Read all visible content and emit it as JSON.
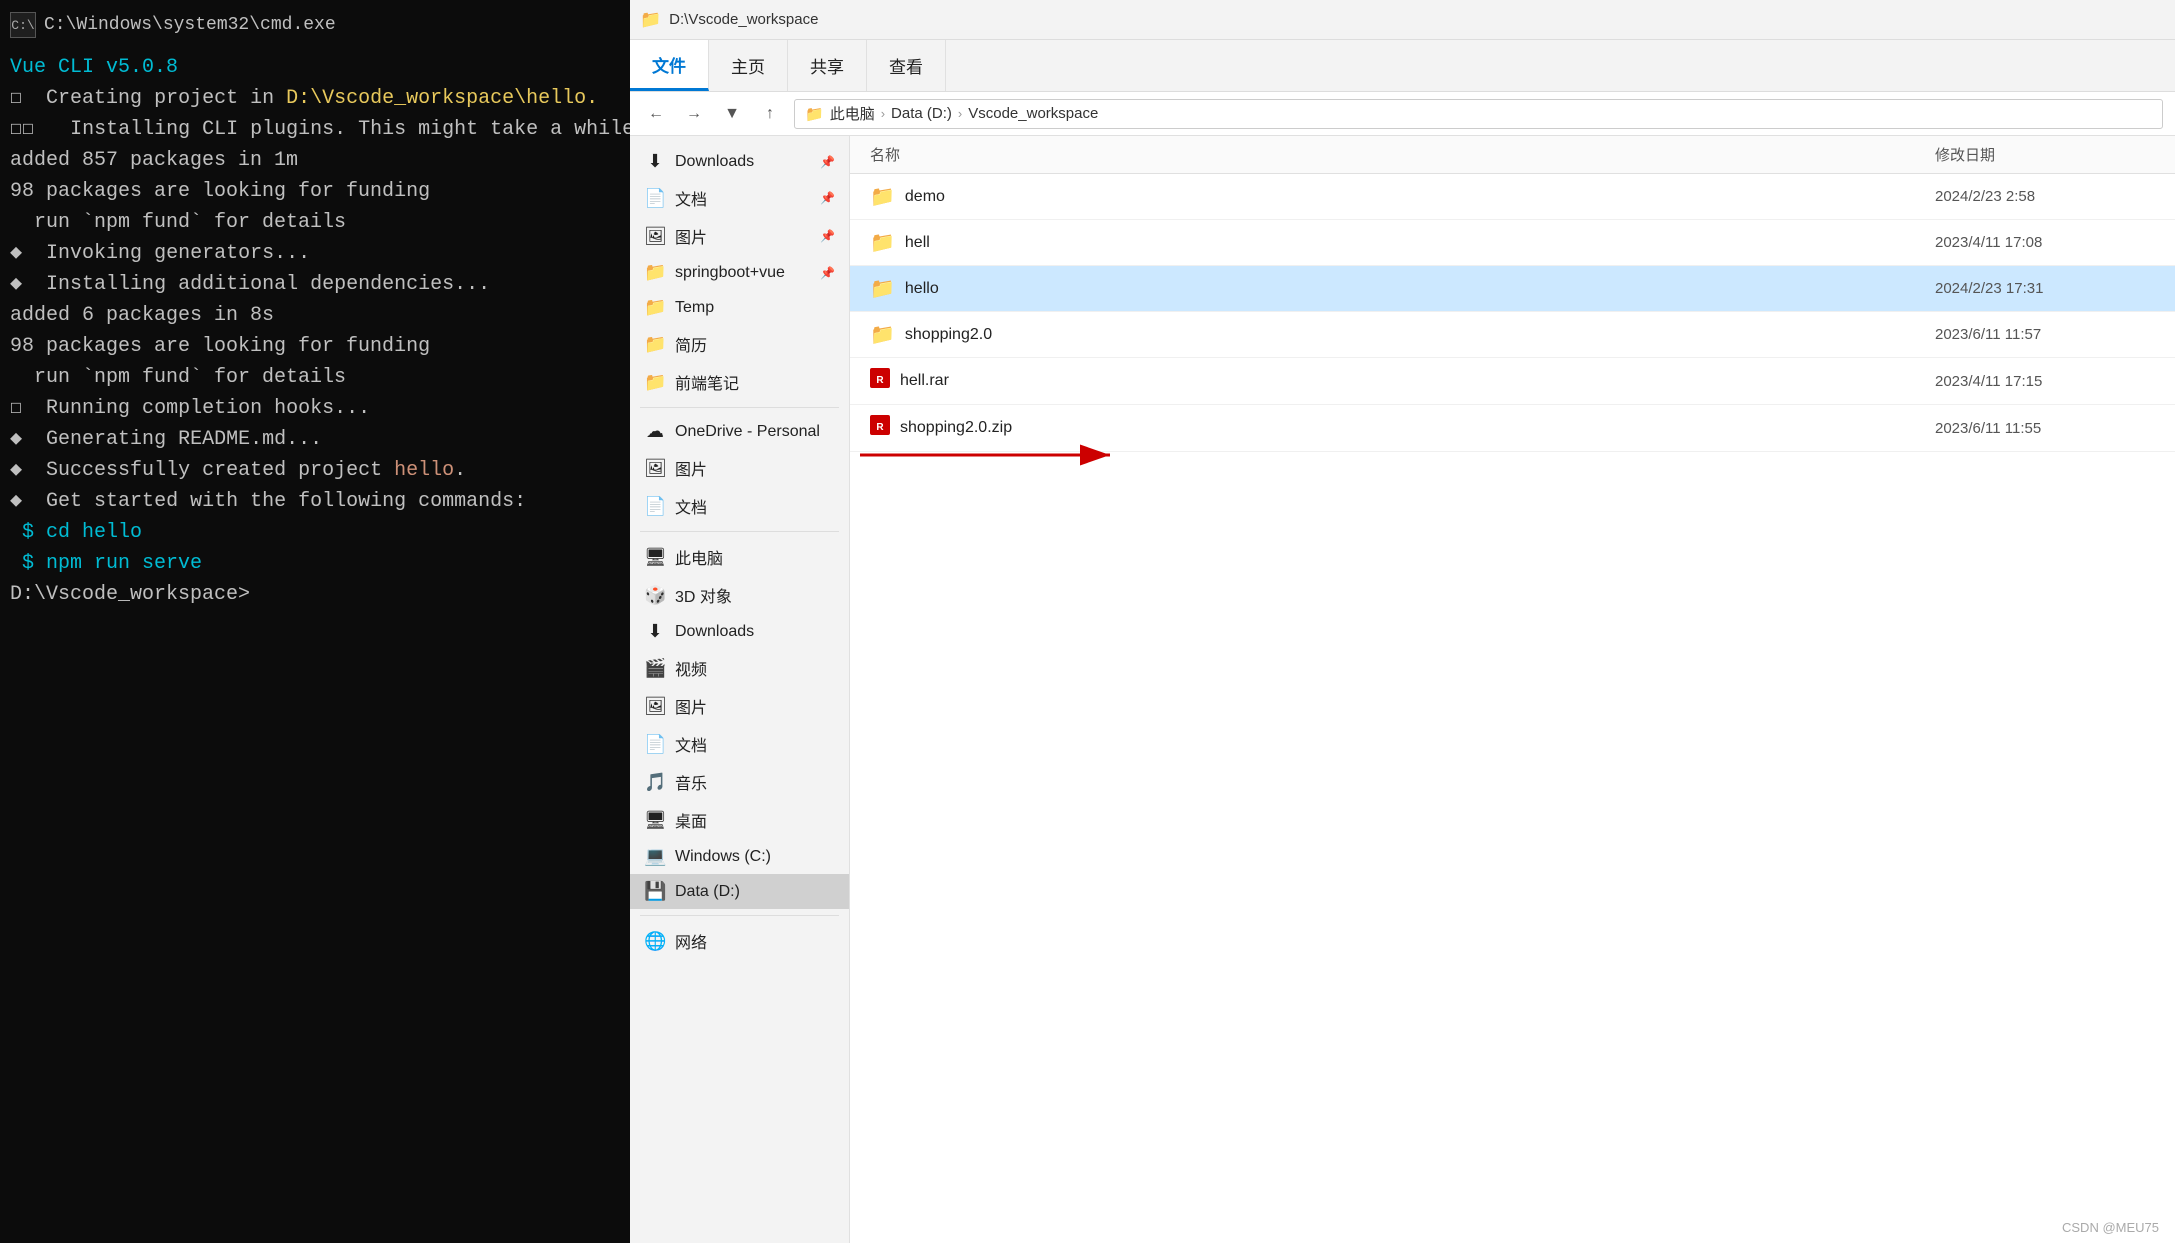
{
  "cmd": {
    "titlebar_icon": "C:\\",
    "title": "C:\\Windows\\system32\\cmd.exe",
    "lines": [
      {
        "text": "Vue CLI v5.0.8",
        "color": "cyan"
      },
      {
        "text": "☐  Creating project in D:\\Vscode_workspace\\hello.",
        "color": "white",
        "highlight": {
          "word": "D:\\Vscode_workspace\\hello.",
          "color": "yellow"
        }
      },
      {
        "text": "☐☐   Installing CLI plugins. This might take a while...",
        "color": "white"
      },
      {
        "text": "",
        "color": "white"
      },
      {
        "text": "added 857 packages in 1m",
        "color": "white"
      },
      {
        "text": "",
        "color": "white"
      },
      {
        "text": "98 packages are looking for funding",
        "color": "white"
      },
      {
        "text": "  run `npm fund` for details",
        "color": "white"
      },
      {
        "text": "◆  Invoking generators...",
        "color": "white"
      },
      {
        "text": "◆  Installing additional dependencies...",
        "color": "white"
      },
      {
        "text": "",
        "color": "white"
      },
      {
        "text": "added 6 packages in 8s",
        "color": "white"
      },
      {
        "text": "",
        "color": "white"
      },
      {
        "text": "98 packages are looking for funding",
        "color": "white"
      },
      {
        "text": "  run `npm fund` for details",
        "color": "white"
      },
      {
        "text": "☐  Running completion hooks...",
        "color": "white"
      },
      {
        "text": "",
        "color": "white"
      },
      {
        "text": "◆  Generating README.md...",
        "color": "white"
      },
      {
        "text": "",
        "color": "white"
      },
      {
        "text": "◆  Successfully created project hello.",
        "color": "white",
        "highlight": {
          "word": "hello",
          "color": "orange"
        }
      },
      {
        "text": "◆  Get started with the following commands:",
        "color": "white"
      },
      {
        "text": "",
        "color": "white"
      },
      {
        "text": " $ cd hello",
        "color": "cyan"
      },
      {
        "text": " $ npm run serve",
        "color": "cyan"
      },
      {
        "text": "",
        "color": "white"
      },
      {
        "text": "",
        "color": "white"
      },
      {
        "text": "D:\\Vscode_workspace>",
        "color": "white"
      }
    ]
  },
  "explorer": {
    "titlebar": {
      "icon": "📁",
      "path": "D:\\Vscode_workspace"
    },
    "ribbon_tabs": [
      "文件",
      "主页",
      "共享",
      "查看"
    ],
    "active_tab": "文件",
    "breadcrumb": {
      "parts": [
        "此电脑",
        "Data (D:)",
        "Vscode_workspace"
      ]
    },
    "sidebar_items": [
      {
        "icon": "⬇",
        "label": "Downloads",
        "pin": "📌",
        "type": "item"
      },
      {
        "icon": "📄",
        "label": "文档",
        "pin": "📌",
        "type": "item"
      },
      {
        "icon": "🖼",
        "label": "图片",
        "pin": "📌",
        "type": "item"
      },
      {
        "icon": "📁",
        "label": "springboot+vue",
        "pin": "📌",
        "type": "item"
      },
      {
        "icon": "📁",
        "label": "Temp",
        "type": "item"
      },
      {
        "icon": "📁",
        "label": "简历",
        "type": "item"
      },
      {
        "icon": "📁",
        "label": "前端笔记",
        "type": "item"
      },
      {
        "type": "divider"
      },
      {
        "icon": "☁",
        "label": "OneDrive - Personal",
        "type": "item"
      },
      {
        "icon": "🖼",
        "label": "图片",
        "type": "item"
      },
      {
        "icon": "📄",
        "label": "文档",
        "type": "item"
      },
      {
        "type": "divider"
      },
      {
        "icon": "🖥",
        "label": "此电脑",
        "type": "item"
      },
      {
        "icon": "🎲",
        "label": "3D 对象",
        "type": "item"
      },
      {
        "icon": "⬇",
        "label": "Downloads",
        "type": "item"
      },
      {
        "icon": "🎬",
        "label": "视频",
        "type": "item"
      },
      {
        "icon": "🖼",
        "label": "图片",
        "type": "item"
      },
      {
        "icon": "📄",
        "label": "文档",
        "type": "item"
      },
      {
        "icon": "🎵",
        "label": "音乐",
        "type": "item"
      },
      {
        "icon": "🖥",
        "label": "桌面",
        "type": "item"
      },
      {
        "icon": "💻",
        "label": "Windows (C:)",
        "type": "item"
      },
      {
        "icon": "💾",
        "label": "Data (D:)",
        "type": "item",
        "selected": true
      },
      {
        "type": "divider"
      },
      {
        "icon": "🌐",
        "label": "网络",
        "type": "item"
      }
    ],
    "file_header": {
      "name": "名称",
      "date": "修改日期"
    },
    "files": [
      {
        "icon": "📁",
        "name": "demo",
        "date": "2024/2/23 2:58",
        "type": "folder"
      },
      {
        "icon": "📁",
        "name": "hell",
        "date": "2023/4/11 17:08",
        "type": "folder"
      },
      {
        "icon": "📁",
        "name": "hello",
        "date": "2024/2/23 17:31",
        "type": "folder",
        "selected": true
      },
      {
        "icon": "📁",
        "name": "shopping2.0",
        "date": "2023/6/11 11:57",
        "type": "folder"
      },
      {
        "icon": "🔴",
        "name": "hell.rar",
        "date": "2023/4/11 17:15",
        "type": "archive"
      },
      {
        "icon": "🔴",
        "name": "shopping2.0.zip",
        "date": "2023/6/11 11:55",
        "type": "archive"
      }
    ],
    "csdn_label": "CSDN @MEU75"
  }
}
